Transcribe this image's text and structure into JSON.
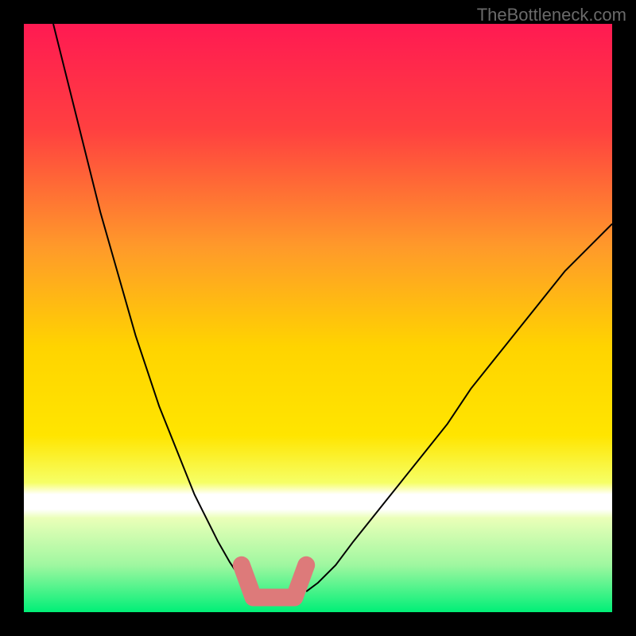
{
  "watermark": "TheBottleneck.com",
  "chart_data": {
    "type": "line",
    "title": "",
    "xlabel": "",
    "ylabel": "",
    "xlim": [
      0,
      100
    ],
    "ylim": [
      0,
      100
    ],
    "background_gradient": {
      "top": "#ff1a52",
      "mid_upper": "#ff7a2a",
      "mid": "#ffe500",
      "mid_lower": "#f3ff66",
      "bottom_band_top": "#f6ffb0",
      "bottom": "#00ef77"
    },
    "series": [
      {
        "name": "left-curve",
        "x": [
          5,
          7,
          9,
          11,
          13,
          15,
          17,
          19,
          21,
          23,
          25,
          27,
          29,
          31,
          33,
          35,
          37,
          38.5
        ],
        "y": [
          100,
          92,
          84,
          76,
          68,
          61,
          54,
          47,
          41,
          35,
          30,
          25,
          20,
          16,
          12,
          8.5,
          5.5,
          3.5
        ],
        "color": "#000000",
        "stroke_width": 2
      },
      {
        "name": "right-curve",
        "x": [
          48,
          50,
          53,
          56,
          60,
          64,
          68,
          72,
          76,
          80,
          84,
          88,
          92,
          96,
          100
        ],
        "y": [
          3.5,
          5,
          8,
          12,
          17,
          22,
          27,
          32,
          38,
          43,
          48,
          53,
          58,
          62,
          66
        ],
        "color": "#000000",
        "stroke_width": 2
      },
      {
        "name": "marker-bracket",
        "type": "path",
        "points": [
          {
            "x": 37,
            "y": 8
          },
          {
            "x": 39,
            "y": 2.5
          },
          {
            "x": 46,
            "y": 2.5
          },
          {
            "x": 48,
            "y": 8
          }
        ],
        "color": "#dd7a7a",
        "stroke_width": 15
      }
    ],
    "bottom_white_band": {
      "y_from": 19,
      "y_to": 23
    }
  }
}
